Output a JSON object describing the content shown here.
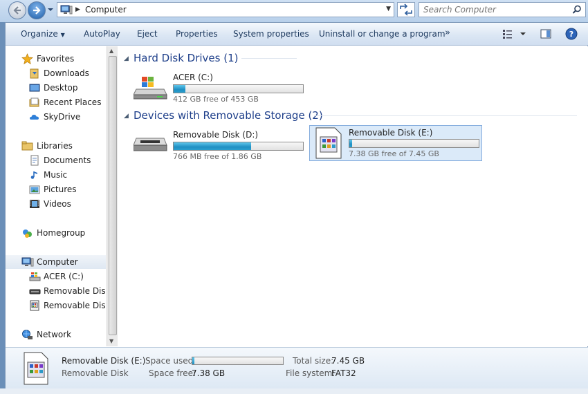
{
  "address": {
    "crumb": "Computer"
  },
  "search": {
    "placeholder": "Search Computer"
  },
  "toolbar": {
    "organize": "Organize",
    "autoplay": "AutoPlay",
    "eject": "Eject",
    "properties": "Properties",
    "system_properties": "System properties",
    "uninstall": "Uninstall or change a program",
    "more": "»"
  },
  "sidebar": {
    "favorites": "Favorites",
    "downloads": "Downloads",
    "desktop": "Desktop",
    "recent_places": "Recent Places",
    "skydrive": "SkyDrive",
    "libraries": "Libraries",
    "documents": "Documents",
    "music": "Music",
    "pictures": "Pictures",
    "videos": "Videos",
    "homegroup": "Homegroup",
    "computer": "Computer",
    "acer_c": "ACER (C:)",
    "removable_d": "Removable Disk (D:)",
    "removable_e": "Removable Disk (E:)",
    "network": "Network"
  },
  "groups": {
    "hdd": "Hard Disk Drives (1)",
    "removable": "Devices with Removable Storage (2)"
  },
  "drives": [
    {
      "name": "ACER (C:)",
      "free": "412 GB free of 453 GB",
      "used_fraction": 0.09
    },
    {
      "name": "Removable Disk (D:)",
      "free": "766 MB free of 1.86 GB",
      "used_fraction": 0.6
    },
    {
      "name": "Removable Disk (E:)",
      "free": "7.38 GB free of 7.45 GB",
      "used_fraction": 0.01
    }
  ],
  "details": {
    "name": "Removable Disk (E:)",
    "type": "Removable Disk",
    "space_used_label": "Space used:",
    "space_free_label": "Space free:",
    "space_free": "7.38 GB",
    "total_size_label": "Total size:",
    "total_size": "7.45 GB",
    "fs_label": "File system:",
    "fs": "FAT32",
    "used_fraction": 0.01
  }
}
